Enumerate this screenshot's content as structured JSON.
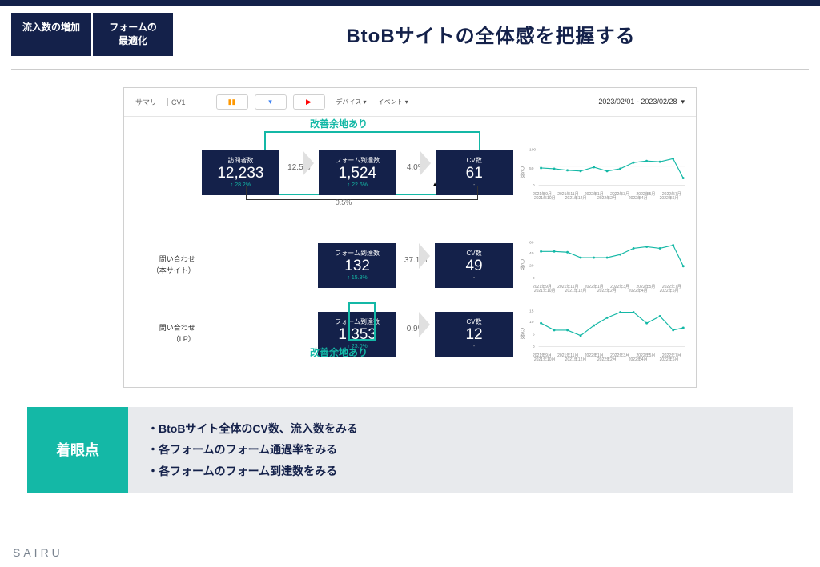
{
  "header": {
    "tab1": "流入数の増加",
    "tab2": "フォームの\n最適化",
    "title": "BtoBサイトの全体感を把握する"
  },
  "dashboard": {
    "summary": "サマリー｜CV1",
    "filter_device": "デバイス",
    "filter_event": "イベント",
    "date_range": "2023/02/01 - 2023/02/28",
    "annotation_top": "改善余地あり",
    "annotation_bottom": "改善余地あり"
  },
  "row1": {
    "visitor_label": "訪問者数",
    "visitor_value": "12,233",
    "visitor_change": "28.2%",
    "rate1": "12.5%",
    "form_label": "フォーム到達数",
    "form_value": "1,524",
    "form_change": "22.6%",
    "rate2": "4.0%",
    "cv_label": "CV数",
    "cv_value": "61",
    "cv_change": "-",
    "direct_rate": "0.5%"
  },
  "row2": {
    "label": "問い合わせ\n（本サイト）",
    "form_label": "フォーム到達数",
    "form_value": "132",
    "form_change": "15.8%",
    "rate": "37.1%",
    "cv_label": "CV数",
    "cv_value": "49",
    "cv_change": "-"
  },
  "row3": {
    "label": "問い合わせ\n（LP）",
    "form_label": "フォーム到達数",
    "form_value": "1,353",
    "form_change": "23.0%",
    "rate": "0.9%",
    "cv_label": "CV数",
    "cv_value": "12",
    "cv_change": "-"
  },
  "chart_data": [
    {
      "type": "line",
      "ylabel": "CV数",
      "ylim": [
        0,
        100
      ],
      "categories": [
        "2021年9月",
        "2021年10月",
        "2021年11月",
        "2021年12月",
        "2022年1月",
        "2022年2月",
        "2022年3月",
        "2022年4月",
        "2022年5月",
        "2022年6月",
        "2022年7月"
      ],
      "values": [
        44,
        42,
        38,
        36,
        45,
        35,
        40,
        55,
        60,
        58,
        65,
        18
      ]
    },
    {
      "type": "line",
      "ylabel": "CV数",
      "ylim": [
        0,
        60
      ],
      "categories": [
        "2021年9月",
        "2021年10月",
        "2021年11月",
        "2021年12月",
        "2022年1月",
        "2022年2月",
        "2022年3月",
        "2022年4月",
        "2022年5月",
        "2022年6月",
        "2022年7月"
      ],
      "values": [
        40,
        40,
        38,
        30,
        30,
        30,
        35,
        45,
        48,
        45,
        50,
        18
      ]
    },
    {
      "type": "line",
      "ylabel": "CV数",
      "ylim": [
        0,
        15
      ],
      "categories": [
        "2021年9月",
        "2021年10月",
        "2021年11月",
        "2021年12月",
        "2022年1月",
        "2022年2月",
        "2022年3月",
        "2022年4月",
        "2022年5月",
        "2022年6月",
        "2022年7月"
      ],
      "values": [
        9,
        6,
        6,
        4,
        8,
        11,
        13,
        13,
        9,
        12,
        6,
        7
      ]
    }
  ],
  "bottom": {
    "label": "着眼点",
    "points": [
      "BtoBサイト全体のCV数、流入数をみる",
      "各フォームのフォーム通過率をみる",
      "各フォームのフォーム到達数をみる"
    ]
  },
  "brand": "SAIRU"
}
